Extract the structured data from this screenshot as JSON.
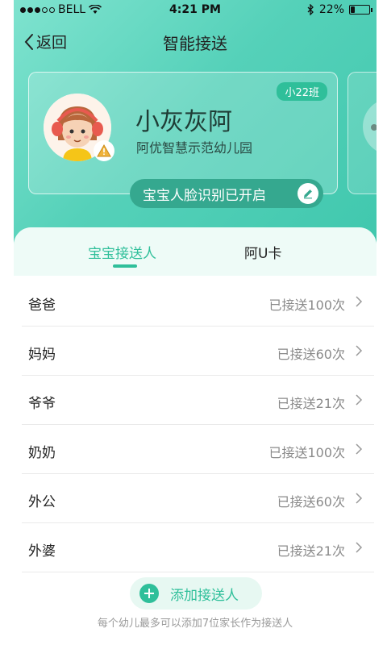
{
  "status_bar": {
    "carrier": "BELL",
    "time": "4:21 PM",
    "battery": "22%",
    "battery_level": 0.22
  },
  "nav": {
    "back_label": "返回",
    "title": "智能接送"
  },
  "child_card": {
    "class_badge": "小22班",
    "name": "小灰灰阿",
    "school": "阿优智慧示范幼儿园",
    "face_status": "宝宝人脸识别已开启"
  },
  "tabs": [
    {
      "label": "宝宝接送人",
      "active": true
    },
    {
      "label": "阿U卡",
      "active": false
    }
  ],
  "pickup_people": [
    {
      "name": "爸爸",
      "count": "已接送100次"
    },
    {
      "name": "妈妈",
      "count": "已接送60次"
    },
    {
      "name": "爷爷",
      "count": "已接送21次"
    },
    {
      "name": "奶奶",
      "count": "已接送100次"
    },
    {
      "name": "外公",
      "count": "已接送60次"
    },
    {
      "name": "外婆",
      "count": "已接送21次"
    }
  ],
  "add_button_label": "添加接送人",
  "hint": "每个幼儿最多可以添加7位家长作为接送人",
  "colors": {
    "accent": "#2fbf9a",
    "hero_gradient_start": "#7fe3cf",
    "hero_gradient_end": "#3fc7ad",
    "pill": "#35a88f"
  },
  "icons": {
    "back": "chevron-left-icon",
    "wifi": "wifi-icon",
    "bluetooth": "bluetooth-icon",
    "edit": "pencil-icon",
    "warning": "warning-icon",
    "row": "chevron-right-icon",
    "add": "plus-icon"
  }
}
